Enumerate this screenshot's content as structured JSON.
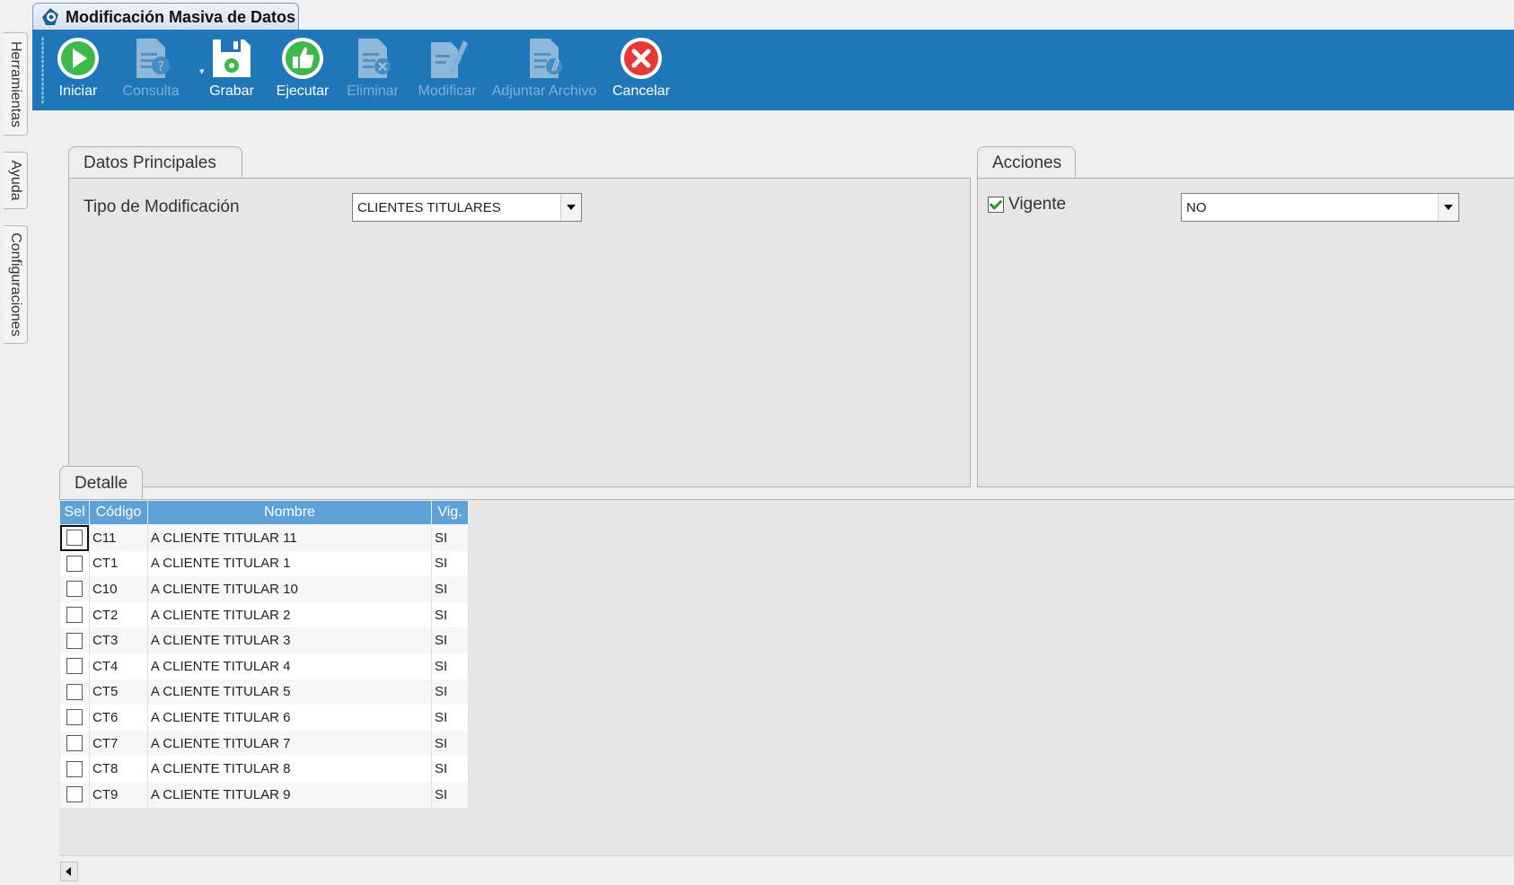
{
  "window": {
    "title": "Modificación Masiva de Datos"
  },
  "side_tabs": [
    {
      "label": "Herramientas"
    },
    {
      "label": "Ayuda"
    },
    {
      "label": "Configuraciones"
    }
  ],
  "toolbar": {
    "buttons": [
      {
        "label": "Iniciar",
        "enabled": true,
        "icon": "play-circle-icon"
      },
      {
        "label": "Consulta",
        "enabled": false,
        "icon": "document-question-icon"
      },
      {
        "label": "Grabar",
        "enabled": true,
        "icon": "floppy-disk-icon"
      },
      {
        "label": "Ejecutar",
        "enabled": true,
        "icon": "thumbs-up-icon"
      },
      {
        "label": "Eliminar",
        "enabled": false,
        "icon": "document-delete-icon"
      },
      {
        "label": "Modificar",
        "enabled": false,
        "icon": "document-edit-icon"
      },
      {
        "label": "Adjuntar Archivo",
        "enabled": false,
        "icon": "document-attach-icon"
      },
      {
        "label": "Cancelar",
        "enabled": true,
        "icon": "cancel-circle-icon"
      }
    ]
  },
  "datos_principales": {
    "tab_label": "Datos Principales",
    "tipo_label": "Tipo de Modificación",
    "tipo_value": "CLIENTES TITULARES"
  },
  "acciones": {
    "tab_label": "Acciones",
    "vigente_label": "Vigente",
    "vigente_checked": true,
    "vigente_value": "NO"
  },
  "detalle": {
    "tab_label": "Detalle",
    "columns": [
      "Sel",
      "Código",
      "Nombre",
      "Vig."
    ],
    "rows": [
      {
        "codigo": "C11",
        "nombre": "A CLIENTE TITULAR  11",
        "vig": "SI",
        "sel": false
      },
      {
        "codigo": "CT1",
        "nombre": "A CLIENTE TITULAR 1",
        "vig": "SI",
        "sel": false
      },
      {
        "codigo": "C10",
        "nombre": "A CLIENTE TITULAR 10",
        "vig": "SI",
        "sel": false
      },
      {
        "codigo": "CT2",
        "nombre": "A CLIENTE TITULAR 2",
        "vig": "SI",
        "sel": false
      },
      {
        "codigo": "CT3",
        "nombre": "A CLIENTE TITULAR 3",
        "vig": "SI",
        "sel": false
      },
      {
        "codigo": "CT4",
        "nombre": "A CLIENTE TITULAR 4",
        "vig": "SI",
        "sel": false
      },
      {
        "codigo": "CT5",
        "nombre": "A CLIENTE TITULAR 5",
        "vig": "SI",
        "sel": false
      },
      {
        "codigo": "CT6",
        "nombre": "A CLIENTE TITULAR 6",
        "vig": "SI",
        "sel": false
      },
      {
        "codigo": "CT7",
        "nombre": "A CLIENTE TITULAR 7",
        "vig": "SI",
        "sel": false
      },
      {
        "codigo": "CT8",
        "nombre": "A CLIENTE TITULAR 8",
        "vig": "SI",
        "sel": false
      },
      {
        "codigo": "CT9",
        "nombre": "A CLIENTE TITULAR 9",
        "vig": "SI",
        "sel": false
      }
    ]
  },
  "colors": {
    "toolbar": "#1f77ba",
    "grid_header": "#5fa2d8",
    "accent_check": "#2a9a2a"
  }
}
